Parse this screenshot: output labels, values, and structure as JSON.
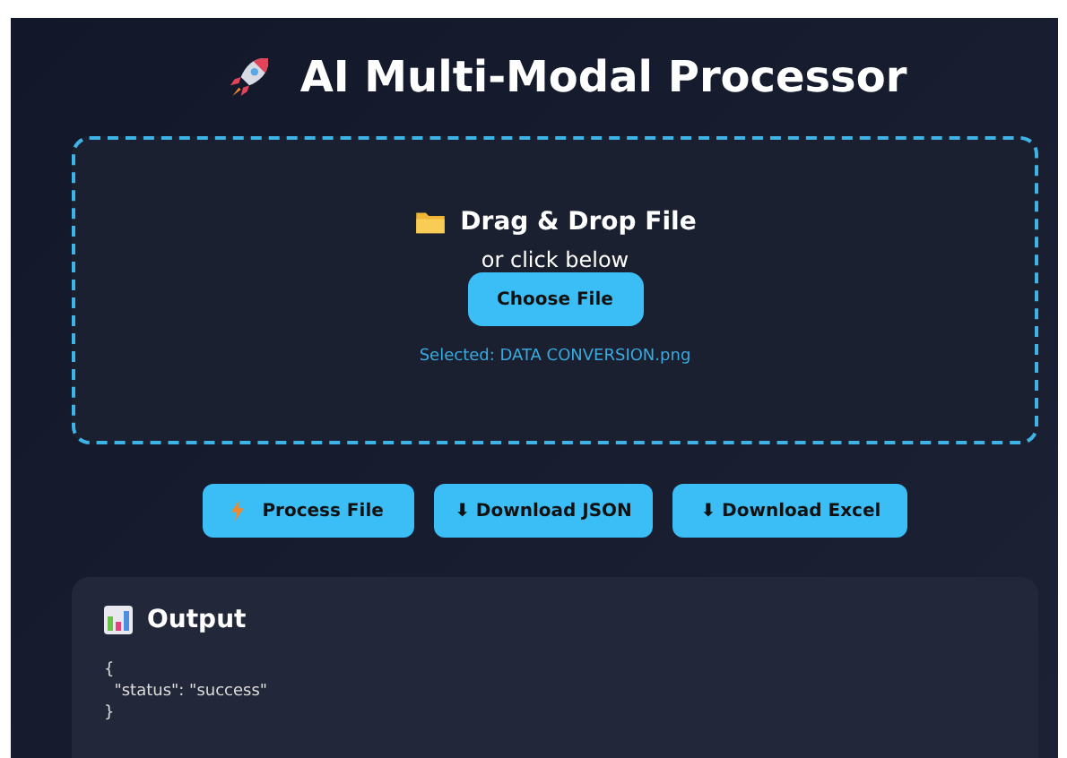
{
  "title": "AI Multi-Modal Processor",
  "dropzone": {
    "heading": "Drag & Drop File",
    "subtext": "or click below",
    "button": "Choose File",
    "selected_file": "Selected: DATA CONVERSION.png"
  },
  "actions": [
    {
      "kind": "process",
      "label": "Process File"
    },
    {
      "kind": "download",
      "label": "⬇ Download JSON"
    },
    {
      "kind": "download",
      "label": "⬇ Download Excel"
    }
  ],
  "output": {
    "heading": "Output",
    "lines": [
      "{",
      "  \"status\": \"success\"",
      "}"
    ]
  }
}
